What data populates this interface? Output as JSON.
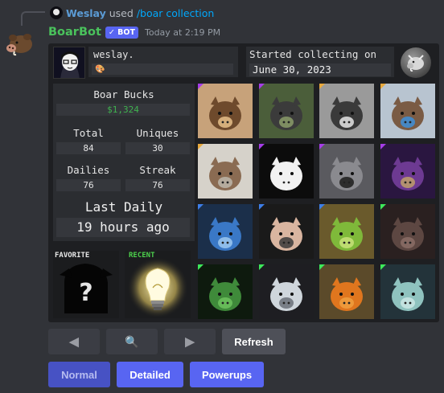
{
  "reply": {
    "user": "Weslay",
    "text": "used",
    "command": "/boar collection"
  },
  "message": {
    "bot_name": "BoarBot",
    "bot_badge": "✓ BOT",
    "timestamp": "Today at 2:19 PM"
  },
  "profile": {
    "username": "weslay.",
    "badge_emoji": "🎨",
    "started_label": "Started collecting on",
    "started_date": "June 30, 2023"
  },
  "stats": {
    "boar_bucks_label": "Boar Bucks",
    "boar_bucks_value": "$1,324",
    "total_label": "Total",
    "total_value": "84",
    "uniques_label": "Uniques",
    "uniques_value": "30",
    "dailies_label": "Dailies",
    "dailies_value": "76",
    "streak_label": "Streak",
    "streak_value": "76",
    "last_daily_label": "Last Daily",
    "last_daily_value": "19 hours ago"
  },
  "favorite": {
    "label": "FAVORITE"
  },
  "recent": {
    "label": "RECENT"
  },
  "rarity_colors": {
    "legendary": "#a63de8",
    "epic": "#e8a93d",
    "rare": "#3d7ee8",
    "uncommon": "#3de85a"
  },
  "collection": [
    {
      "name": "tourist-boar",
      "rarity": "legendary"
    },
    {
      "name": "garden-boar",
      "rarity": "legendary"
    },
    {
      "name": "reaper-boar",
      "rarity": "epic"
    },
    {
      "name": "sleepy-boar",
      "rarity": "epic"
    },
    {
      "name": "tissue-boar",
      "rarity": "epic"
    },
    {
      "name": "cow-boar",
      "rarity": "legendary"
    },
    {
      "name": "moon-boar",
      "rarity": "legendary"
    },
    {
      "name": "wizard-boar",
      "rarity": "legendary"
    },
    {
      "name": "crystal-ball-boar",
      "rarity": "rare"
    },
    {
      "name": "keyboard-boar",
      "rarity": "rare"
    },
    {
      "name": "avocado-boar",
      "rarity": "rare"
    },
    {
      "name": "dark-boar",
      "rarity": "uncommon"
    },
    {
      "name": "green-boar",
      "rarity": "uncommon"
    },
    {
      "name": "rain-cloud-boar",
      "rarity": "uncommon"
    },
    {
      "name": "pumpkin-boar",
      "rarity": "uncommon"
    },
    {
      "name": "ghost-boar",
      "rarity": "uncommon"
    }
  ],
  "buttons": {
    "prev_icon": "◀",
    "search_icon": "🔍",
    "next_icon": "▶",
    "refresh_label": "Refresh",
    "normal_label": "Normal",
    "detailed_label": "Detailed",
    "powerups_label": "Powerups"
  }
}
